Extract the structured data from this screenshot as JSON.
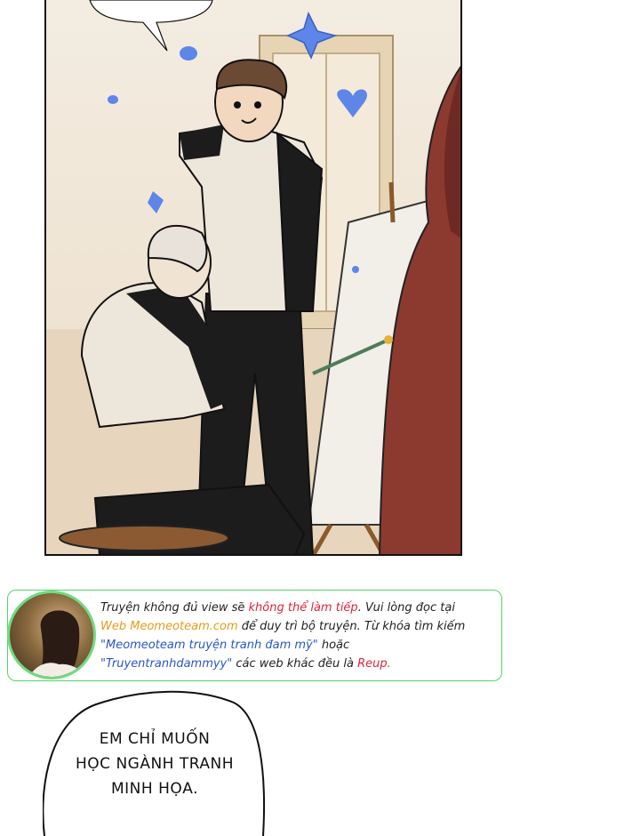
{
  "notice": {
    "line1_a": "Truyện không đủ view sẽ ",
    "line1_b": "không thể làm tiếp",
    "line1_c": ". Vui lòng đọc tại",
    "line2_a": "Web Meomeoteam.com",
    "line2_b": " để duy trì bộ truyện. Từ khóa tìm kiếm",
    "line3_a": "\"Meomeoteam truyện tranh đam mỹ\"",
    "line3_b": " hoặc",
    "line4_a": "\"Truyentranhdammyy\"",
    "line4_b": " các web khác đều là ",
    "line4_c": "Reup."
  },
  "speech_bubble": {
    "line1": "EM CHỈ MUỐN",
    "line2": "HỌC NGÀNH TRANH",
    "line3": "MINH HỌA."
  },
  "colors": {
    "notice_border": "#55d56b",
    "warning_red": "#e0243b",
    "site_orange": "#e89a1a",
    "keyword_blue": "#2a55c7"
  }
}
